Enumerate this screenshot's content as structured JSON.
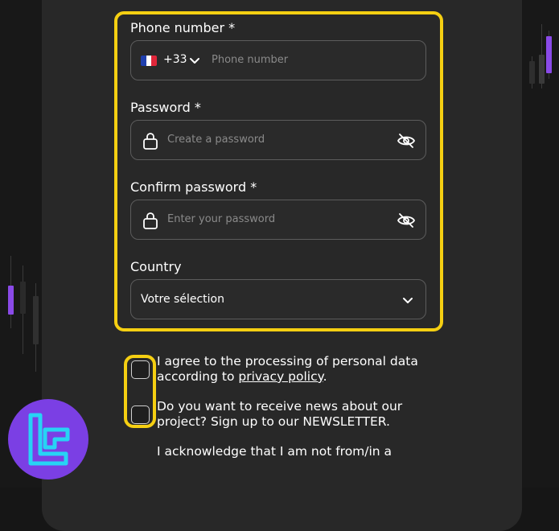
{
  "form": {
    "phone": {
      "label": "Phone number *",
      "dial_code": "+33",
      "country_flag": "france-flag",
      "placeholder": "Phone number"
    },
    "password": {
      "label": "Password *",
      "placeholder": "Create a password"
    },
    "confirm_password": {
      "label": "Confirm password *",
      "placeholder": "Enter your password"
    },
    "country": {
      "label": "Country",
      "selected": "Votre sélection"
    }
  },
  "consents": {
    "privacy_text": "I agree to the processing of personal data according to ",
    "privacy_link": "privacy policy",
    "privacy_suffix": ".",
    "newsletter_text": "Do you want to receive news about our project? Sign up to our NEWSLETTER.",
    "acknowledge_text": "I acknowledge that I am not from/in a"
  },
  "colors": {
    "highlight": "#f5cf12",
    "card": "#282828",
    "accent": "#7b3fe4",
    "logo_mark": "#27d3f5"
  },
  "icons": [
    "lock-icon",
    "eye-off-icon",
    "chevron-down-icon",
    "france-flag"
  ]
}
